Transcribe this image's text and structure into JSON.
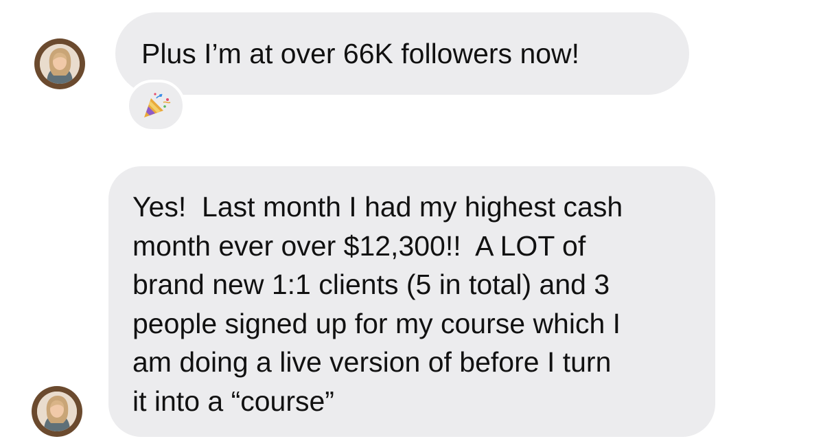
{
  "messages": [
    {
      "sender": "contact",
      "text": "Plus I’m at over 66K followers now!",
      "reaction": {
        "icon": "party-popper-icon",
        "glyph": "🎉"
      }
    },
    {
      "sender": "contact",
      "lines": [
        "Yes!  Last month I had my highest cash",
        "month ever over $12,300!!  A LOT of",
        "brand new 1:1 clients (5 in total) and 3",
        "people signed up for my course which I",
        "am doing a live version of before I turn",
        "it into a “course”"
      ]
    }
  ],
  "colors": {
    "bubble": "#ececee",
    "text": "#111111",
    "avatar_ring": "#6b4a2e",
    "background": "#ffffff"
  }
}
